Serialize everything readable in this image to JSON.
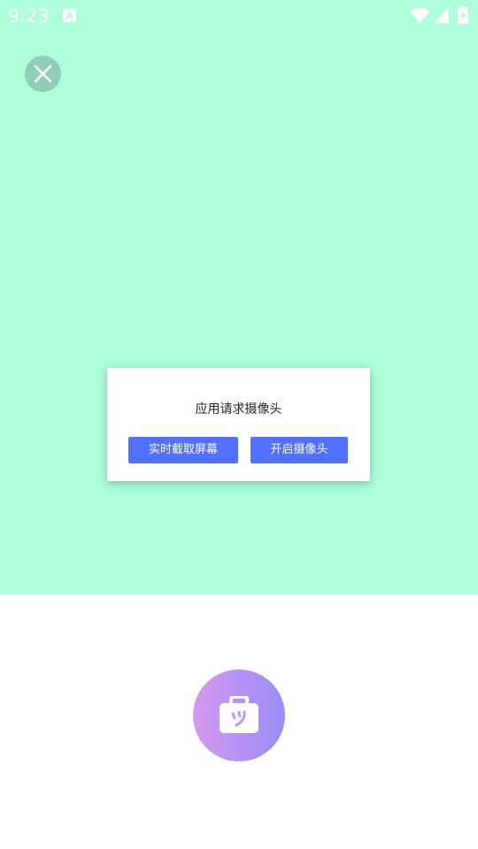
{
  "status_bar": {
    "time": "9:23",
    "icons": [
      "a-notification-icon",
      "wifi-icon",
      "signal-icon",
      "battery-charging-icon"
    ]
  },
  "colors": {
    "camera_background": "#adfed9",
    "close_button": "#8fcdb7",
    "dialog_button": "#5270ff",
    "shutter_gradient_start": "#d59bef",
    "shutter_gradient_end": "#9b8cf6"
  },
  "close_button": {
    "icon": "close-icon"
  },
  "dialog": {
    "message": "应用请求摄像头",
    "screen_capture_label": "实时截取屏幕",
    "open_camera_label": "开启摄像头"
  },
  "shutter": {
    "icon": "camera-icon"
  }
}
